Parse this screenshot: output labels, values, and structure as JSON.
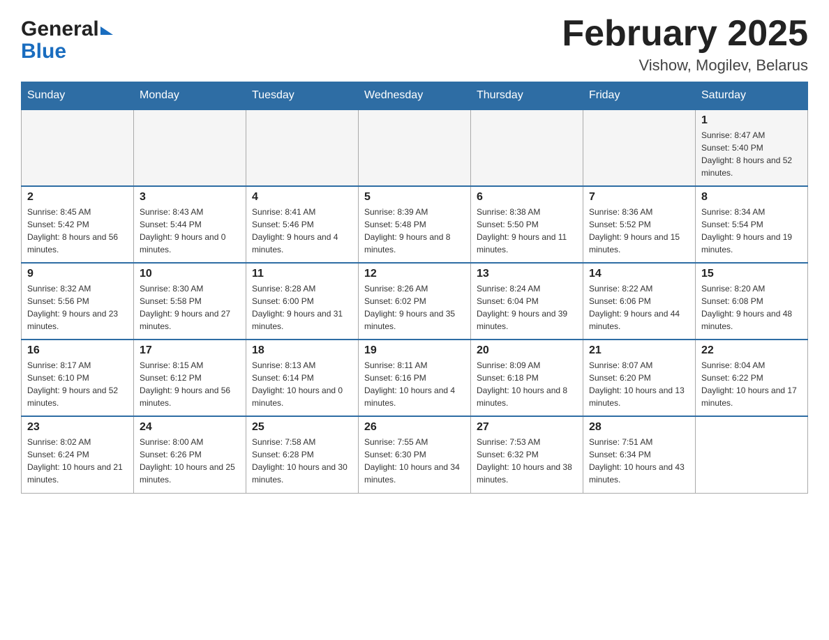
{
  "logo": {
    "general": "General",
    "blue": "Blue"
  },
  "header": {
    "month": "February 2025",
    "location": "Vishow, Mogilev, Belarus"
  },
  "weekdays": [
    "Sunday",
    "Monday",
    "Tuesday",
    "Wednesday",
    "Thursday",
    "Friday",
    "Saturday"
  ],
  "weeks": [
    [
      {
        "day": "",
        "sunrise": "",
        "sunset": "",
        "daylight": ""
      },
      {
        "day": "",
        "sunrise": "",
        "sunset": "",
        "daylight": ""
      },
      {
        "day": "",
        "sunrise": "",
        "sunset": "",
        "daylight": ""
      },
      {
        "day": "",
        "sunrise": "",
        "sunset": "",
        "daylight": ""
      },
      {
        "day": "",
        "sunrise": "",
        "sunset": "",
        "daylight": ""
      },
      {
        "day": "",
        "sunrise": "",
        "sunset": "",
        "daylight": ""
      },
      {
        "day": "1",
        "sunrise": "Sunrise: 8:47 AM",
        "sunset": "Sunset: 5:40 PM",
        "daylight": "Daylight: 8 hours and 52 minutes."
      }
    ],
    [
      {
        "day": "2",
        "sunrise": "Sunrise: 8:45 AM",
        "sunset": "Sunset: 5:42 PM",
        "daylight": "Daylight: 8 hours and 56 minutes."
      },
      {
        "day": "3",
        "sunrise": "Sunrise: 8:43 AM",
        "sunset": "Sunset: 5:44 PM",
        "daylight": "Daylight: 9 hours and 0 minutes."
      },
      {
        "day": "4",
        "sunrise": "Sunrise: 8:41 AM",
        "sunset": "Sunset: 5:46 PM",
        "daylight": "Daylight: 9 hours and 4 minutes."
      },
      {
        "day": "5",
        "sunrise": "Sunrise: 8:39 AM",
        "sunset": "Sunset: 5:48 PM",
        "daylight": "Daylight: 9 hours and 8 minutes."
      },
      {
        "day": "6",
        "sunrise": "Sunrise: 8:38 AM",
        "sunset": "Sunset: 5:50 PM",
        "daylight": "Daylight: 9 hours and 11 minutes."
      },
      {
        "day": "7",
        "sunrise": "Sunrise: 8:36 AM",
        "sunset": "Sunset: 5:52 PM",
        "daylight": "Daylight: 9 hours and 15 minutes."
      },
      {
        "day": "8",
        "sunrise": "Sunrise: 8:34 AM",
        "sunset": "Sunset: 5:54 PM",
        "daylight": "Daylight: 9 hours and 19 minutes."
      }
    ],
    [
      {
        "day": "9",
        "sunrise": "Sunrise: 8:32 AM",
        "sunset": "Sunset: 5:56 PM",
        "daylight": "Daylight: 9 hours and 23 minutes."
      },
      {
        "day": "10",
        "sunrise": "Sunrise: 8:30 AM",
        "sunset": "Sunset: 5:58 PM",
        "daylight": "Daylight: 9 hours and 27 minutes."
      },
      {
        "day": "11",
        "sunrise": "Sunrise: 8:28 AM",
        "sunset": "Sunset: 6:00 PM",
        "daylight": "Daylight: 9 hours and 31 minutes."
      },
      {
        "day": "12",
        "sunrise": "Sunrise: 8:26 AM",
        "sunset": "Sunset: 6:02 PM",
        "daylight": "Daylight: 9 hours and 35 minutes."
      },
      {
        "day": "13",
        "sunrise": "Sunrise: 8:24 AM",
        "sunset": "Sunset: 6:04 PM",
        "daylight": "Daylight: 9 hours and 39 minutes."
      },
      {
        "day": "14",
        "sunrise": "Sunrise: 8:22 AM",
        "sunset": "Sunset: 6:06 PM",
        "daylight": "Daylight: 9 hours and 44 minutes."
      },
      {
        "day": "15",
        "sunrise": "Sunrise: 8:20 AM",
        "sunset": "Sunset: 6:08 PM",
        "daylight": "Daylight: 9 hours and 48 minutes."
      }
    ],
    [
      {
        "day": "16",
        "sunrise": "Sunrise: 8:17 AM",
        "sunset": "Sunset: 6:10 PM",
        "daylight": "Daylight: 9 hours and 52 minutes."
      },
      {
        "day": "17",
        "sunrise": "Sunrise: 8:15 AM",
        "sunset": "Sunset: 6:12 PM",
        "daylight": "Daylight: 9 hours and 56 minutes."
      },
      {
        "day": "18",
        "sunrise": "Sunrise: 8:13 AM",
        "sunset": "Sunset: 6:14 PM",
        "daylight": "Daylight: 10 hours and 0 minutes."
      },
      {
        "day": "19",
        "sunrise": "Sunrise: 8:11 AM",
        "sunset": "Sunset: 6:16 PM",
        "daylight": "Daylight: 10 hours and 4 minutes."
      },
      {
        "day": "20",
        "sunrise": "Sunrise: 8:09 AM",
        "sunset": "Sunset: 6:18 PM",
        "daylight": "Daylight: 10 hours and 8 minutes."
      },
      {
        "day": "21",
        "sunrise": "Sunrise: 8:07 AM",
        "sunset": "Sunset: 6:20 PM",
        "daylight": "Daylight: 10 hours and 13 minutes."
      },
      {
        "day": "22",
        "sunrise": "Sunrise: 8:04 AM",
        "sunset": "Sunset: 6:22 PM",
        "daylight": "Daylight: 10 hours and 17 minutes."
      }
    ],
    [
      {
        "day": "23",
        "sunrise": "Sunrise: 8:02 AM",
        "sunset": "Sunset: 6:24 PM",
        "daylight": "Daylight: 10 hours and 21 minutes."
      },
      {
        "day": "24",
        "sunrise": "Sunrise: 8:00 AM",
        "sunset": "Sunset: 6:26 PM",
        "daylight": "Daylight: 10 hours and 25 minutes."
      },
      {
        "day": "25",
        "sunrise": "Sunrise: 7:58 AM",
        "sunset": "Sunset: 6:28 PM",
        "daylight": "Daylight: 10 hours and 30 minutes."
      },
      {
        "day": "26",
        "sunrise": "Sunrise: 7:55 AM",
        "sunset": "Sunset: 6:30 PM",
        "daylight": "Daylight: 10 hours and 34 minutes."
      },
      {
        "day": "27",
        "sunrise": "Sunrise: 7:53 AM",
        "sunset": "Sunset: 6:32 PM",
        "daylight": "Daylight: 10 hours and 38 minutes."
      },
      {
        "day": "28",
        "sunrise": "Sunrise: 7:51 AM",
        "sunset": "Sunset: 6:34 PM",
        "daylight": "Daylight: 10 hours and 43 minutes."
      },
      {
        "day": "",
        "sunrise": "",
        "sunset": "",
        "daylight": ""
      }
    ]
  ]
}
